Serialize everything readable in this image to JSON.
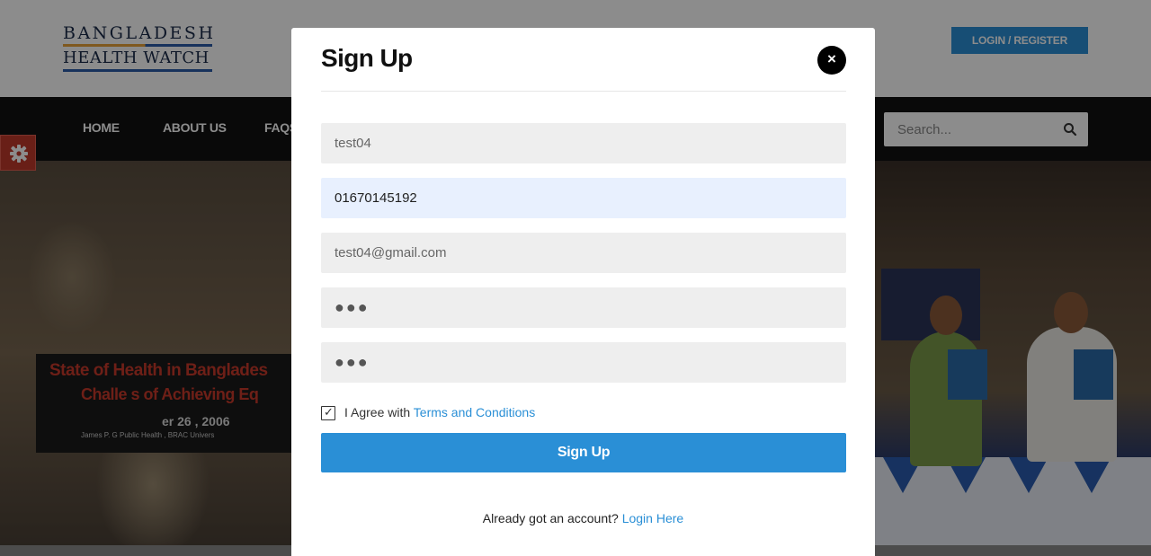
{
  "header": {
    "logo_line1": "BANGLADESH",
    "logo_line2": "HEALTH WATCH",
    "login_register_label": "LOGIN / REGISTER"
  },
  "nav": {
    "items": [
      {
        "label": "HOME"
      },
      {
        "label": "ABOUT US"
      },
      {
        "label": "FAQS"
      }
    ],
    "search_placeholder": "Search..."
  },
  "hero": {
    "banner_line1": "State of Health in Banglades",
    "banner_line2": "Challe    s of Achieving Eq",
    "banner_date": "er 26 , 2006",
    "banner_small": "James P. G      Public Health , BRAC Univers"
  },
  "modal": {
    "title": "Sign Up",
    "close_label": "×",
    "fields": {
      "username": "test04",
      "phone": "01670145192",
      "email": "test04@gmail.com",
      "password": "●●●",
      "confirm_password": "●●●"
    },
    "agree_prefix": "I Agree with ",
    "terms_link": "Terms and Conditions",
    "checkbox_mark": "✓",
    "submit_label": "Sign Up",
    "already_text": "Already got an account? ",
    "login_link": "Login Here"
  },
  "colors": {
    "accent": "#2a8fd6",
    "navbar": "#111111",
    "gear_tab": "#c0392b"
  }
}
